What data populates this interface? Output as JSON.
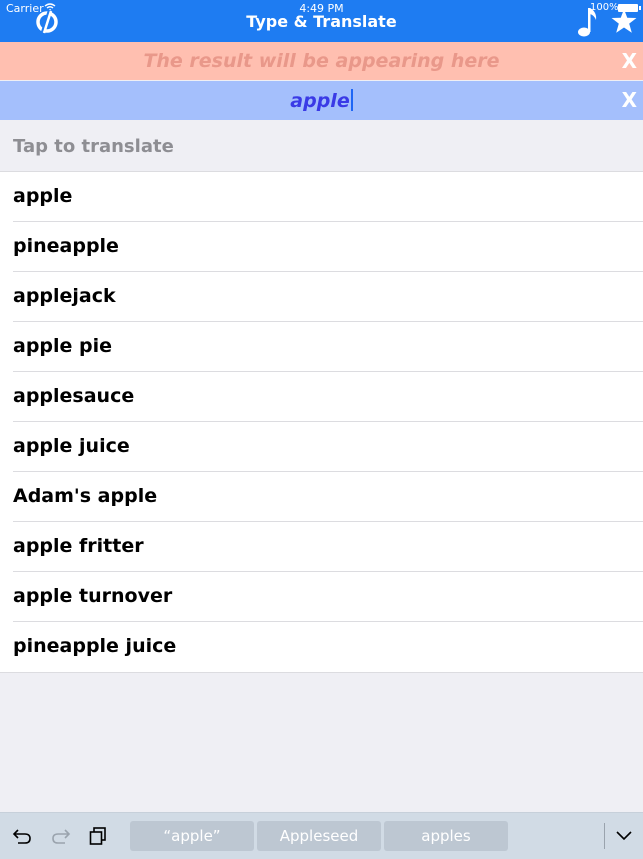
{
  "status_bar": {
    "carrier": "Carrier",
    "time": "4:49 PM",
    "battery": "100%"
  },
  "nav": {
    "title": "Type & Translate",
    "logo_icon": "logo-icon",
    "music_icon": "music-note-icon",
    "favorites_icon": "star-icon",
    "bar_color": "#1e7cf2"
  },
  "result": {
    "placeholder": "The result will be appearing here",
    "clear_label": "X",
    "bar_color": "#ffbfb0"
  },
  "input": {
    "value": "apple",
    "clear_label": "X",
    "bar_color": "#a4bffc"
  },
  "list": {
    "header": "Tap to translate",
    "items": [
      "apple",
      "pineapple",
      "applejack",
      "apple pie",
      "applesauce",
      "apple juice",
      "Adam's apple",
      "apple fritter",
      "apple turnover",
      "pineapple juice"
    ]
  },
  "keyboard_bar": {
    "tools": [
      "undo-icon",
      "redo-icon",
      "paste-icon"
    ],
    "suggestions": [
      "“apple”",
      "Appleseed",
      "apples"
    ],
    "dismiss_icon": "chevron-down-icon"
  }
}
